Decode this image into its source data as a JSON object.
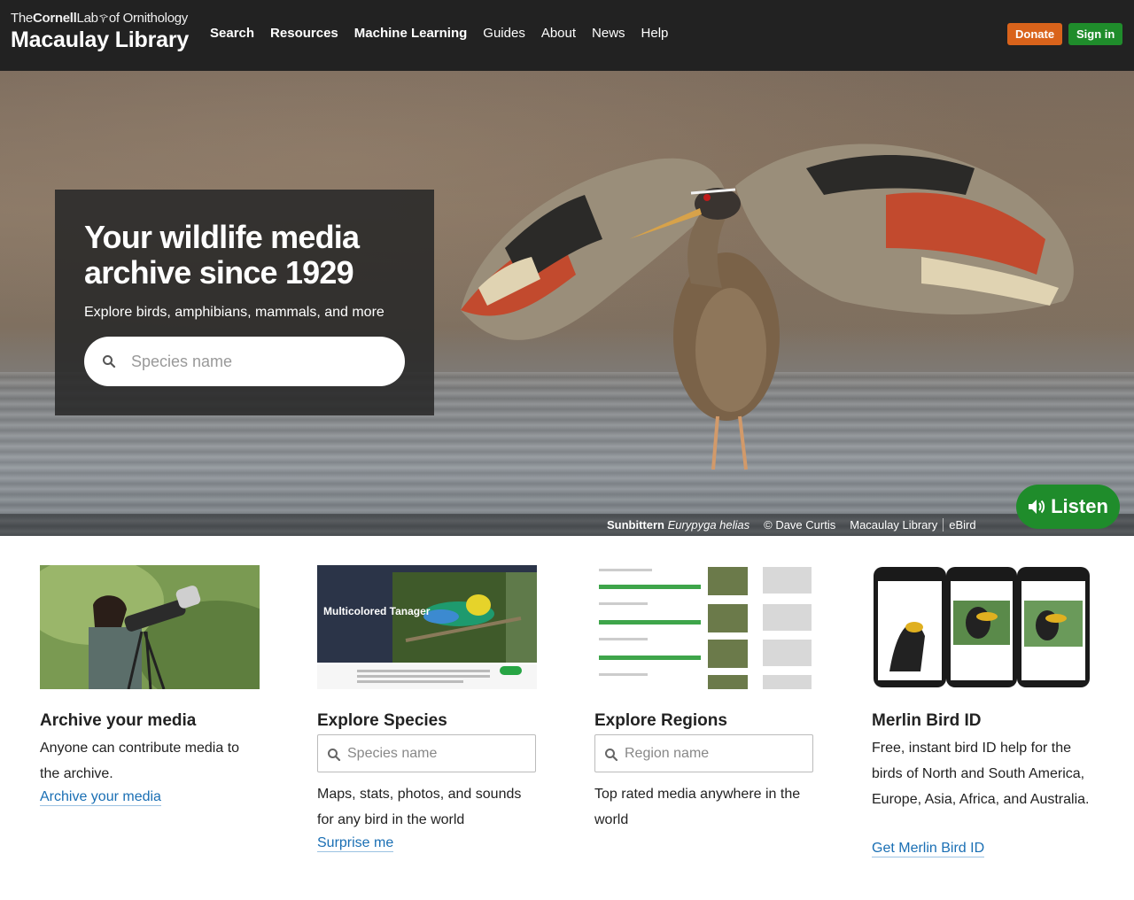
{
  "header": {
    "logo_top_the": "The",
    "logo_top_cornell": "Cornell",
    "logo_top_lab": "Lab",
    "logo_top_orn": "of Ornithology",
    "logo_main": "Macaulay Library",
    "nav": [
      {
        "label": "Search",
        "strong": true
      },
      {
        "label": "Resources",
        "strong": true
      },
      {
        "label": "Machine Learning",
        "strong": true
      },
      {
        "label": "Guides",
        "strong": false
      },
      {
        "label": "About",
        "strong": false
      },
      {
        "label": "News",
        "strong": false
      },
      {
        "label": "Help",
        "strong": false
      }
    ],
    "donate_label": "Donate",
    "signin_label": "Sign in",
    "donate_color": "#d9631b",
    "signin_color": "#1f8c2b"
  },
  "hero": {
    "title": "Your wildlife media archive since 1929",
    "subtitle": "Explore birds, amphibians, mammals, and more",
    "search_placeholder": "Species name",
    "caption_common": "Sunbittern",
    "caption_sci": "Eurypyga helias",
    "caption_credit": "© Dave Curtis",
    "caption_library": "Macaulay Library",
    "caption_ebird": "eBird",
    "listen_label": "Listen"
  },
  "cards": {
    "archive": {
      "title": "Archive your media",
      "text": "Anyone can contribute media to the archive.",
      "link": "Archive your media"
    },
    "species": {
      "title": "Explore Species",
      "placeholder": "Species name",
      "text": "Maps, stats, photos, and sounds for any bird in the world",
      "link": "Surprise me",
      "thumb_title": "Multicolored Tanager"
    },
    "regions": {
      "title": "Explore Regions",
      "placeholder": "Region name",
      "text": "Top rated media anywhere in the world"
    },
    "merlin": {
      "title": "Merlin Bird ID",
      "text": "Free, instant bird ID help for the birds of North and South America, Europe, Asia, Africa, and Australia.",
      "link": "Get Merlin Bird ID"
    }
  },
  "colors": {
    "accent_link": "#1a6fb4",
    "header_bg": "#222222",
    "listen_green": "#1f8c2b"
  }
}
